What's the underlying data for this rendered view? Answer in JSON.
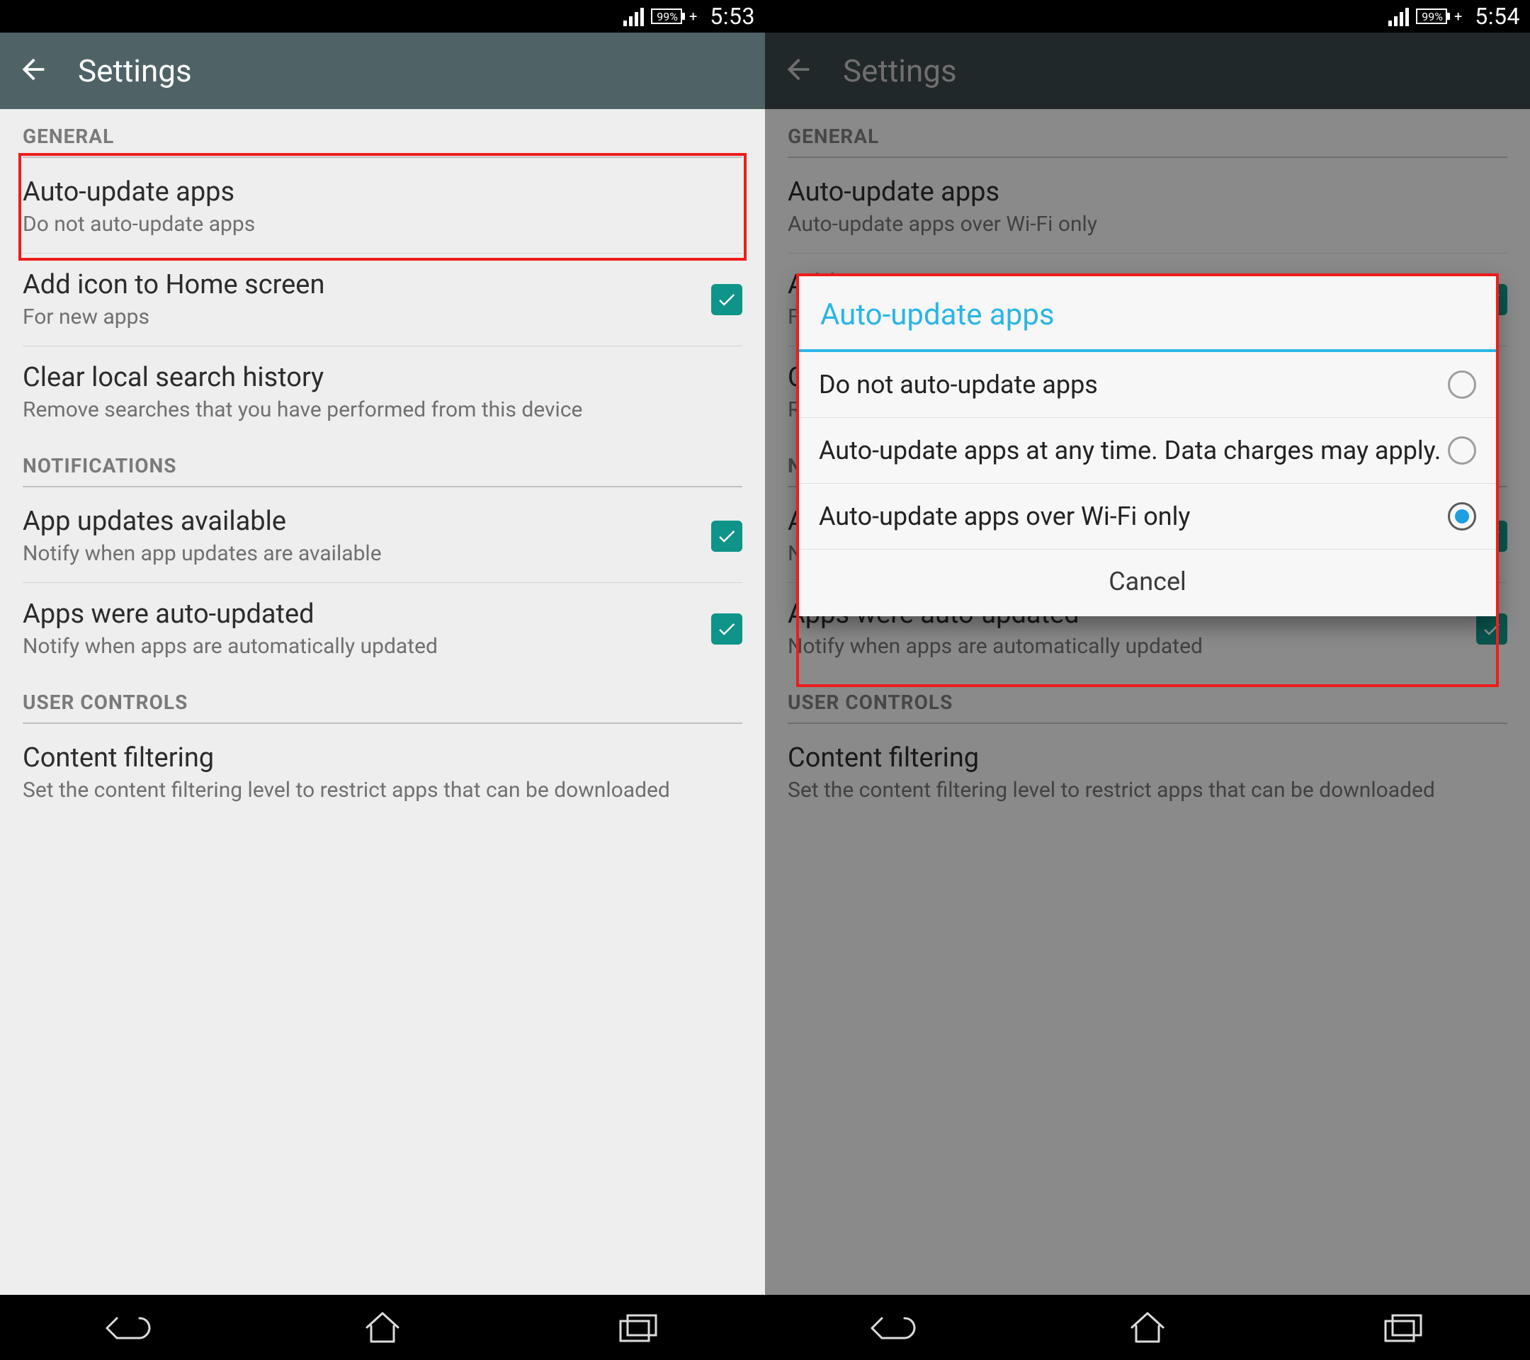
{
  "left": {
    "status": {
      "battery": "99%",
      "time": "5:53"
    },
    "appbar": {
      "title": "Settings"
    },
    "sections": {
      "general": "GENERAL",
      "notifications": "NOTIFICATIONS",
      "user_controls": "USER CONTROLS"
    },
    "rows": {
      "auto_update": {
        "title": "Auto-update apps",
        "sub": "Do not auto-update apps"
      },
      "add_icon": {
        "title": "Add icon to Home screen",
        "sub": "For new apps"
      },
      "clear_hist": {
        "title": "Clear local search history",
        "sub": "Remove searches that you have performed from this device"
      },
      "updates_avail": {
        "title": "App updates available",
        "sub": "Notify when app updates are available"
      },
      "were_updated": {
        "title": "Apps were auto-updated",
        "sub": "Notify when apps are automatically updated"
      },
      "content_filter": {
        "title": "Content filtering",
        "sub": "Set the content filtering level to restrict apps that can be downloaded"
      }
    }
  },
  "right": {
    "status": {
      "battery": "99%",
      "time": "5:54"
    },
    "appbar": {
      "title": "Settings"
    },
    "sections": {
      "general": "GENERAL",
      "notifications": "NOTIFICATIONS",
      "user_controls": "USER CONTROLS"
    },
    "rows": {
      "auto_update": {
        "title": "Auto-update apps",
        "sub": "Auto-update apps over Wi-Fi only"
      },
      "add_icon": {
        "title": "Add icon to Home screen",
        "sub": "For new apps"
      },
      "clear_hist": {
        "title": "Clear local search history",
        "sub": "Remove searches that you have performed from this device"
      },
      "updates_avail": {
        "title": "App updates available",
        "sub": "Notify when app updates are available"
      },
      "were_updated": {
        "title": "Apps were auto-updated",
        "sub": "Notify when apps are automatically updated"
      },
      "content_filter": {
        "title": "Content filtering",
        "sub": "Set the content filtering level to restrict apps that can be downloaded"
      }
    },
    "dialog": {
      "title": "Auto-update apps",
      "options": [
        "Do not auto-update apps",
        "Auto-update apps at any time. Data charges may apply.",
        "Auto-update apps over Wi-Fi only"
      ],
      "selected": 2,
      "cancel": "Cancel"
    }
  }
}
